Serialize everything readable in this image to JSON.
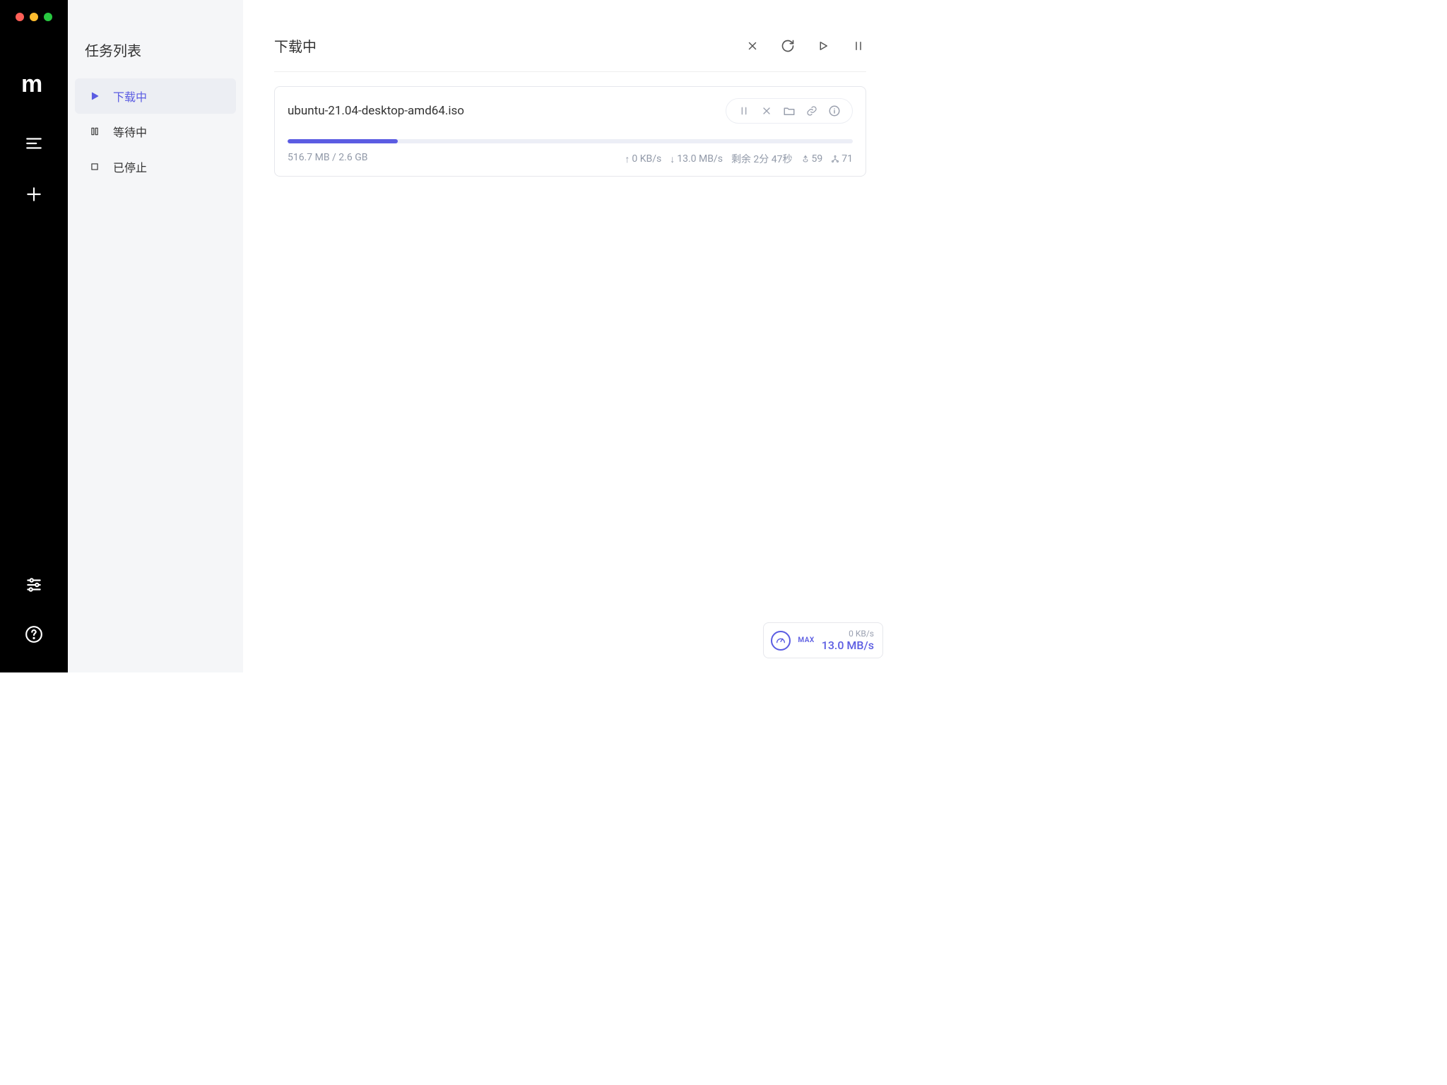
{
  "sidebar": {
    "title": "任务列表",
    "items": [
      {
        "label": "下载中",
        "icon": "play-icon",
        "active": true
      },
      {
        "label": "等待中",
        "icon": "pause-icon",
        "active": false
      },
      {
        "label": "已停止",
        "icon": "stop-icon",
        "active": false
      }
    ]
  },
  "main": {
    "title": "下载中",
    "actions": [
      "close",
      "refresh",
      "start",
      "pause"
    ]
  },
  "task": {
    "name": "ubuntu-21.04-desktop-amd64.iso",
    "size_text": "516.7 MB / 2.6 GB",
    "progress_percent": 19.5,
    "upload_speed": "0 KB/s",
    "download_speed": "13.0 MB/s",
    "remaining": "剩余 2分 47秒",
    "seeds": "59",
    "peers": "71"
  },
  "speed_widget": {
    "max_label": "MAX",
    "upload": "0 KB/s",
    "download": "13.0 MB/s"
  }
}
